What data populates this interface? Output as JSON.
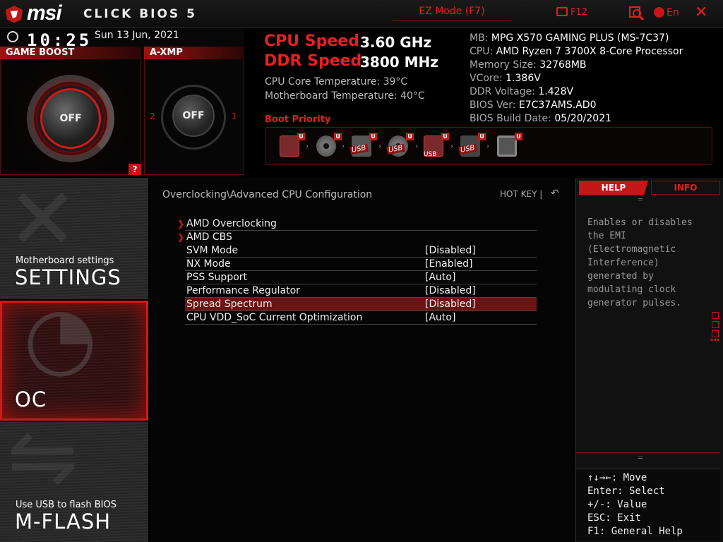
{
  "header": {
    "brand": "msi",
    "product": "CLICK BIOS 5",
    "ez_mode": "EZ Mode (F7)",
    "f12": "F12",
    "language": "En",
    "close": "✕"
  },
  "status": {
    "time": "10:25",
    "date": "Sun  13 Jun, 2021"
  },
  "game_boost": {
    "label": "GAME BOOST",
    "state": "OFF"
  },
  "axmp": {
    "label": "A-XMP",
    "state": "OFF",
    "left_mark": "2",
    "right_mark": "1"
  },
  "help_button": "?",
  "speeds": {
    "cpu_label": "CPU Speed",
    "cpu_value": "3.60 GHz",
    "ddr_label": "DDR Speed",
    "ddr_value": "3800 MHz",
    "cpu_temp": "CPU Core Temperature: 39°C",
    "mb_temp": "Motherboard Temperature: 40°C"
  },
  "sysinfo": [
    {
      "label": "MB:",
      "value": "MPG X570 GAMING PLUS (MS-7C37)"
    },
    {
      "label": "CPU:",
      "value": "AMD Ryzen 7 3700X 8-Core Processor"
    },
    {
      "label": "Memory Size:",
      "value": "32768MB"
    },
    {
      "label": "VCore:",
      "value": "1.386V"
    },
    {
      "label": "DDR Voltage:",
      "value": "1.428V"
    },
    {
      "label": "BIOS Ver:",
      "value": "E7C37AMS.AD0"
    },
    {
      "label": "BIOS Build Date:",
      "value": "05/20/2021"
    }
  ],
  "boot": {
    "label": "Boot Priority",
    "badge": "U",
    "devices": [
      {
        "name": "hdd",
        "usb": ""
      },
      {
        "name": "optical",
        "usb": ""
      },
      {
        "name": "usb-hdd",
        "usb": "USB"
      },
      {
        "name": "usb-optical",
        "usb": "USB"
      },
      {
        "name": "usb-key",
        "usb": "USB"
      },
      {
        "name": "usb-floppy",
        "usb": "USB"
      },
      {
        "name": "network",
        "usb": ""
      }
    ]
  },
  "nav": {
    "settings_sub": "Motherboard settings",
    "settings": "SETTINGS",
    "oc": "OC",
    "mflash_sub": "Use USB to flash BIOS",
    "mflash": "M-FLASH"
  },
  "main": {
    "breadcrumb": "Overclocking\\Advanced CPU Configuration",
    "hotkey": "HOT KEY  |",
    "rows": [
      {
        "label": "AMD Overclocking",
        "value": ""
      },
      {
        "label": "AMD CBS",
        "value": ""
      },
      {
        "label": "SVM Mode",
        "value": "[Disabled]"
      },
      {
        "label": "NX Mode",
        "value": "[Enabled]"
      },
      {
        "label": "PSS Support",
        "value": "[Auto]"
      },
      {
        "label": "Performance Regulator",
        "value": "[Disabled]"
      },
      {
        "label": "Spread Spectrum",
        "value": "[Disabled]"
      },
      {
        "label": "CPU VDD_SoC Current Optimization",
        "value": "[Auto]"
      }
    ]
  },
  "right": {
    "tab_help": "HELP",
    "tab_info": "INFO",
    "help_text": "Enables or disables\nthe EMI\n(Electromagnetic\nInterference)\ngenerated by\nmodulating clock\ngenerator pulses.",
    "keys": [
      "↑↓→←: Move",
      "Enter: Select",
      "+/-: Value",
      "ESC: Exit",
      "F1: General Help"
    ]
  },
  "colors": {
    "accent": "#e02020",
    "selection": "#6a1414"
  }
}
